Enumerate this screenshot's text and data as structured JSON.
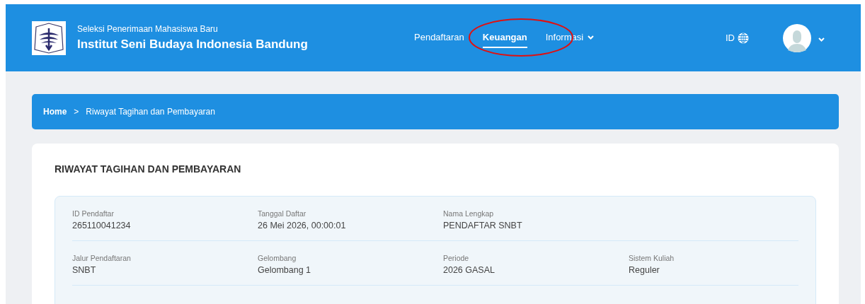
{
  "header": {
    "subtitle": "Seleksi Penerimaan Mahasiswa Baru",
    "title": "Institut Seni Budaya Indonesia Bandung"
  },
  "nav": [
    {
      "label": "Pendaftaran",
      "selected": false,
      "dropdown": false
    },
    {
      "label": "Keuangan",
      "selected": true,
      "dropdown": false
    },
    {
      "label": "Informasi",
      "selected": false,
      "dropdown": true
    }
  ],
  "language": "ID",
  "breadcrumb": [
    {
      "label": "Home"
    },
    {
      "label": "Riwayat Tagihan dan Pembayaran"
    }
  ],
  "breadcrumb_separator": ">",
  "card": {
    "title": "RIWAYAT TAGIHAN DAN PEMBAYARAN",
    "rows": [
      [
        {
          "label": "ID Pendaftar",
          "value": "265110041234"
        },
        {
          "label": "Tanggal Daftar",
          "value": "26 Mei 2026, 00:00:01"
        },
        {
          "label": "Nama Lengkap",
          "value": "PENDAFTAR SNBT"
        }
      ],
      [
        {
          "label": "Jalur Pendaftaran",
          "value": "SNBT"
        },
        {
          "label": "Gelombang",
          "value": "Gelombang 1"
        },
        {
          "label": "Periode",
          "value": "2026 GASAL"
        },
        {
          "label": "Sistem Kuliah",
          "value": "Reguler"
        }
      ]
    ]
  }
}
